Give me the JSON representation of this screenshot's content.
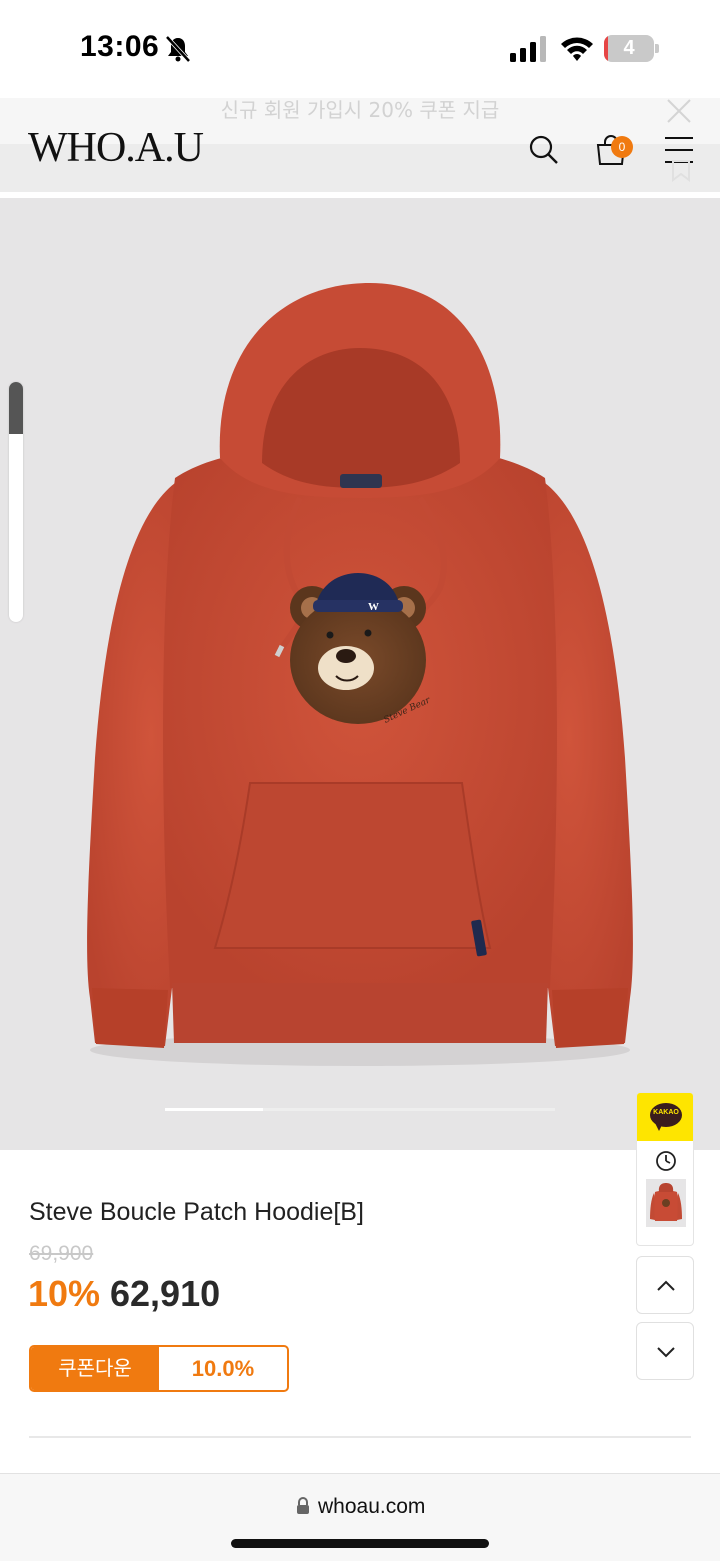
{
  "status_bar": {
    "time": "13:06",
    "battery_level": "4",
    "battery_fraction": 0.04
  },
  "promo": {
    "text": "신규 회원 가입시 20% 쿠폰 지급"
  },
  "header": {
    "logo": "WHO.A.U",
    "cart_count": "0"
  },
  "product": {
    "name": "Steve Boucle Patch Hoodie[B]",
    "original_price": "69,900",
    "discount_rate": "10%",
    "sale_price": "62,910",
    "color": "#c94a33",
    "image_slide_fraction": 0.25
  },
  "coupon": {
    "label": "쿠폰다운",
    "value": "10.0%"
  },
  "side_widget": {
    "kakao_label": "KAKAO"
  },
  "browser": {
    "url": "whoau.com"
  },
  "colors": {
    "accent": "#f07a10",
    "kakao": "#fee500",
    "image_bg": "#e6e5e6"
  }
}
